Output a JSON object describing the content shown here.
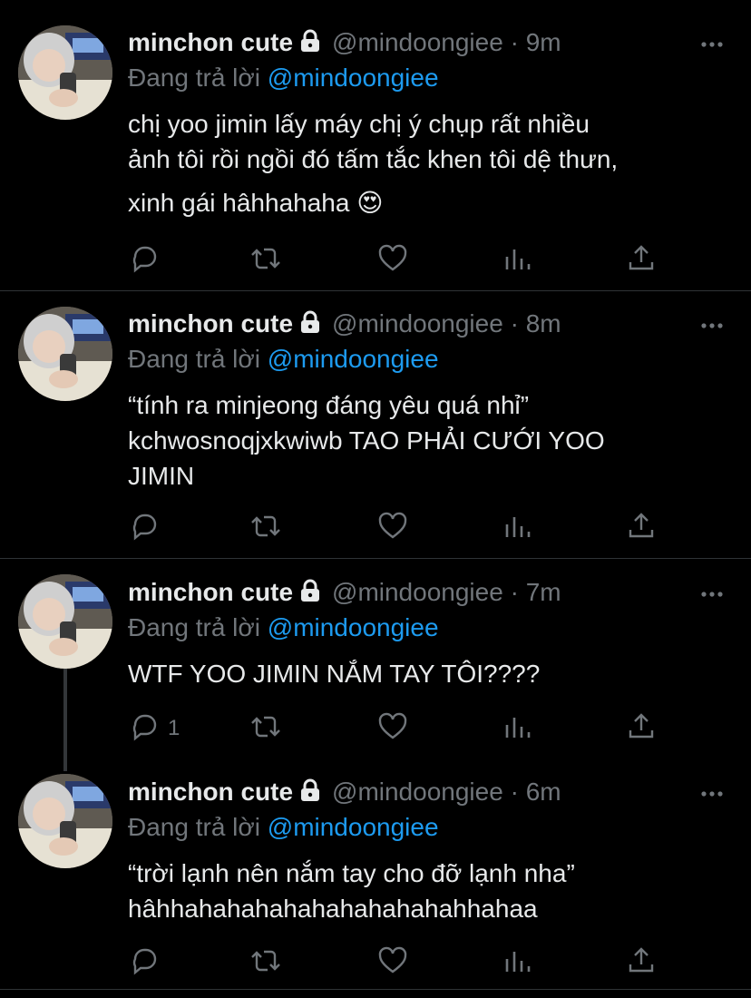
{
  "tweets": [
    {
      "name": "minchon cute",
      "handle": "@mindoongiee",
      "time": "9m",
      "reply_prefix": "Đang trả lời",
      "reply_to": "@mindoongiee",
      "lines": [
        "chị yoo jimin lấy máy chị ý chụp rất nhiều",
        "ảnh tôi rồi ngồi đó tấm tắc khen tôi dệ thưn,",
        "xinh gái hâhhahaha 😍"
      ],
      "reply_count": ""
    },
    {
      "name": "minchon cute",
      "handle": "@mindoongiee",
      "time": "8m",
      "reply_prefix": "Đang trả lời",
      "reply_to": "@mindoongiee",
      "lines": [
        "“tính ra minjeong đáng yêu quá nhỉ”",
        "kchwosnoqjxkwiwb TAO PHẢI CƯỚI YOO",
        "JIMIN"
      ],
      "reply_count": ""
    },
    {
      "name": "minchon cute",
      "handle": "@mindoongiee",
      "time": "7m",
      "reply_prefix": "Đang trả lời",
      "reply_to": "@mindoongiee",
      "lines": [
        "WTF YOO JIMIN NẮM TAY TÔI????"
      ],
      "reply_count": "1"
    },
    {
      "name": "minchon cute",
      "handle": "@mindoongiee",
      "time": "6m",
      "reply_prefix": "Đang trả lời",
      "reply_to": "@mindoongiee",
      "lines": [
        "“trời lạnh nên nắm tay cho đỡ lạnh nha”",
        "hâhhahahahahahahahahahahhahaa"
      ],
      "reply_count": ""
    }
  ],
  "icons": {
    "protected": "lock-icon",
    "more": "more-icon",
    "reply": "reply-icon",
    "retweet": "retweet-icon",
    "like": "heart-icon",
    "analytics": "analytics-icon",
    "share": "share-icon"
  },
  "colors": {
    "background": "#000000",
    "text": "#e7e9ea",
    "muted": "#71767b",
    "link": "#1d9bf0",
    "separator": "#2f3336"
  }
}
